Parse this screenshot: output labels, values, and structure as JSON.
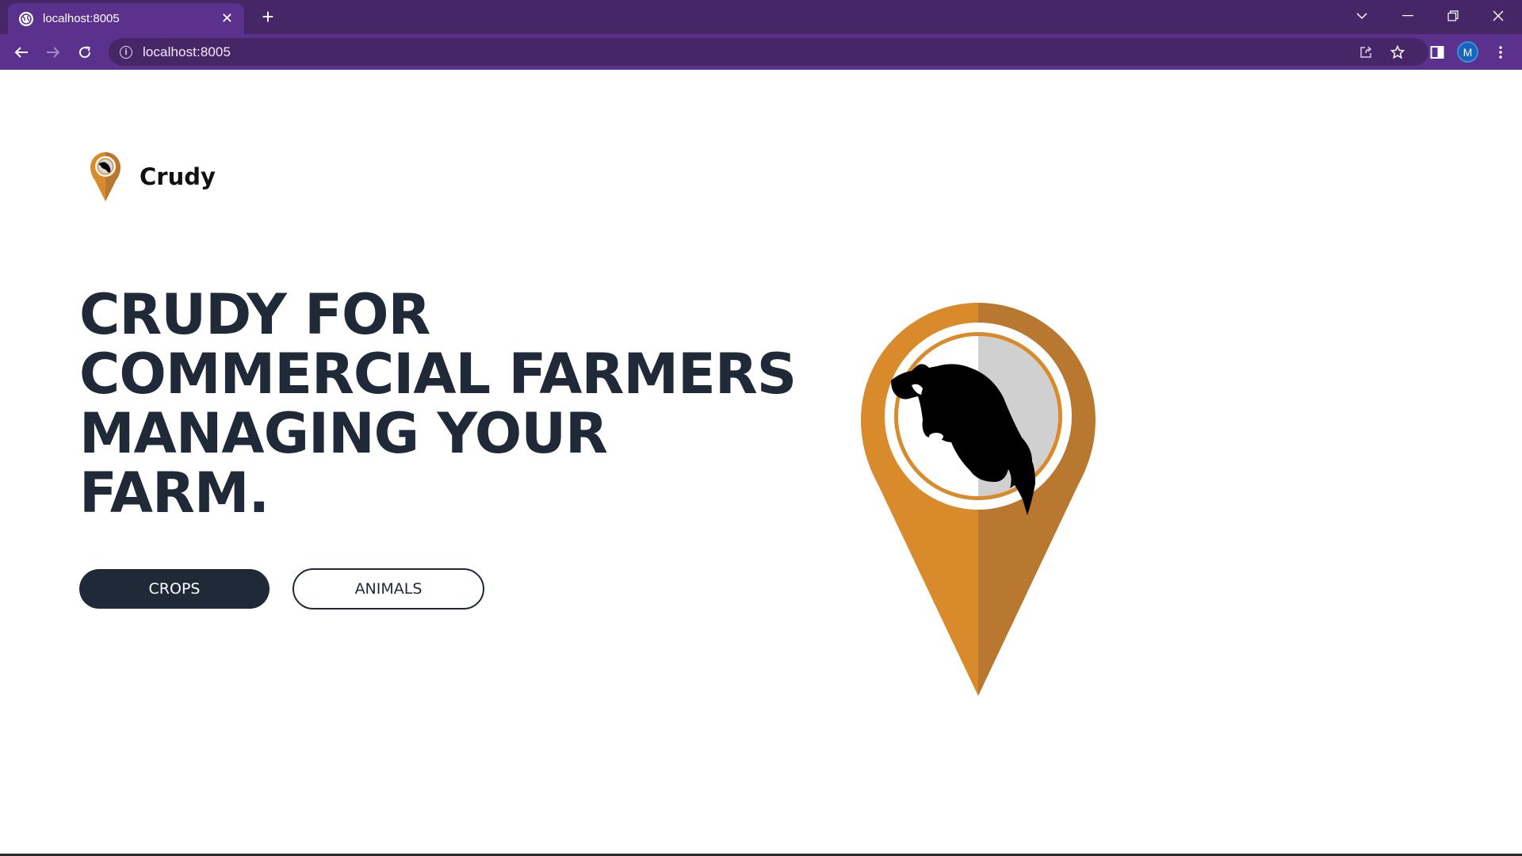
{
  "browser": {
    "tab_title": "localhost:8005",
    "tab_close": "✕",
    "new_tab": "+",
    "url": "localhost:8005",
    "profile_initial": "M"
  },
  "page": {
    "brand_name": "Crudy",
    "hero_lines": [
      "CRUDY FOR",
      "COMMERCIAL FARMERS",
      "MANAGING YOUR",
      "FARM."
    ],
    "buttons": {
      "crops": "CROPS",
      "animals": "ANIMALS"
    }
  },
  "colors": {
    "chrome_dark": "#472668",
    "chrome_light": "#5a318c",
    "text_dark": "#1f2937",
    "pin_orange": "#d98a2a",
    "pin_orange_dark": "#b87830"
  }
}
